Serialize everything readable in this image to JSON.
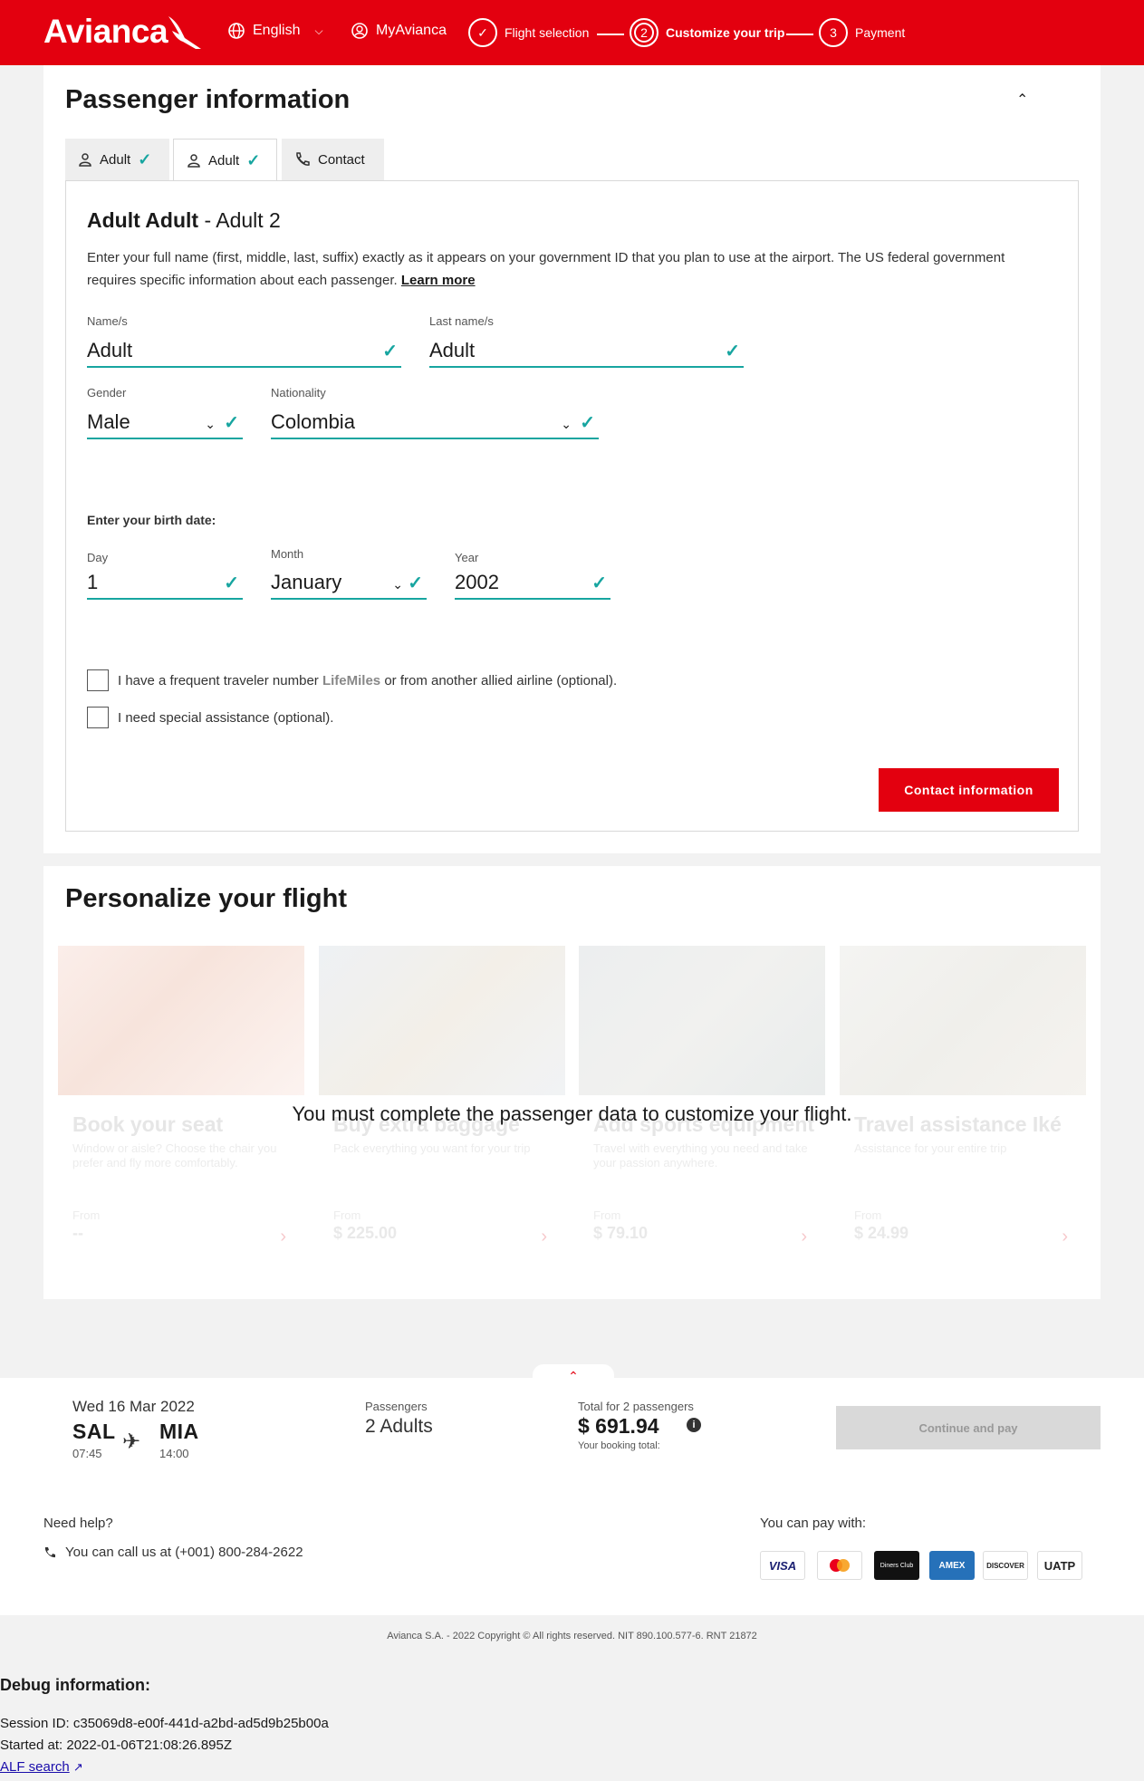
{
  "header": {
    "logo": "Avianca",
    "language": "English",
    "my_account": "MyAvianca",
    "steps": [
      {
        "number": "✓",
        "label": "Flight selection"
      },
      {
        "number": "2",
        "label": "Customize your trip"
      },
      {
        "number": "3",
        "label": "Payment"
      }
    ]
  },
  "passenger": {
    "section_title": "Passenger information",
    "tabs": [
      {
        "label": "Adult",
        "icon": "person-icon"
      },
      {
        "label": "Adult",
        "icon": "person-icon"
      },
      {
        "label": "Contact",
        "icon": "phone-icon"
      }
    ],
    "heading_bold": "Adult Adult",
    "heading_rest": " - Adult 2",
    "intro": "Enter your full name (first, middle, last, suffix) exactly as it appears on your government ID that you plan to use at the airport. The US federal government requires specific information about each passenger.",
    "learn_more": "Learn more",
    "fields": {
      "name_label": "Name/s",
      "name_value": "Adult",
      "lastname_label": "Last name/s",
      "lastname_value": "Adult",
      "gender_label": "Gender",
      "gender_value": "Male",
      "nationality_label": "Nationality",
      "nationality_value": "Colombia",
      "birth_label": "Enter your birth date:",
      "day_label": "Day",
      "day_value": "1",
      "month_label": "Month",
      "month_value": "January",
      "year_label": "Year",
      "year_value": "2002"
    },
    "checkboxes": {
      "ff_pre": "I have a frequent traveler number ",
      "ff_brand": "LifeMiles",
      "ff_post": " or from another allied airline (optional).",
      "assist": "I need special assistance (optional)."
    },
    "contact_button": "Contact information"
  },
  "personalize": {
    "section_title": "Personalize your flight",
    "overlay": "You must complete the passenger data to customize your flight.",
    "services": [
      {
        "title": "Book your seat",
        "desc": "Window or aisle? Choose the chair you prefer and fly more comfortably.",
        "from": "From",
        "price": "--"
      },
      {
        "title": "Buy extra baggage",
        "desc": "Pack everything you want for your trip",
        "from": "From",
        "price": "$ 225.00"
      },
      {
        "title": "Add sports equipment",
        "desc": "Travel with everything you need and take your passion anywhere.",
        "from": "From",
        "price": "$ 79.10"
      },
      {
        "title": "Travel assistance Iké",
        "desc": "Assistance for your entire trip",
        "from": "From",
        "price": "$ 24.99"
      }
    ]
  },
  "summary": {
    "date": "Wed 16 Mar 2022",
    "origin": "SAL",
    "origin_time": "07:45",
    "destination": "MIA",
    "destination_time": "14:00",
    "passengers_label": "Passengers",
    "passengers_value": "2 Adults",
    "total_label": "Total for 2 passengers",
    "total_value": "$ 691.94",
    "booking_label": "Your booking total:",
    "continue": "Continue and pay"
  },
  "footer": {
    "need_help": "Need help?",
    "call": "You can call us at (+001) 800-284-2622",
    "pay_with": "You can pay with:",
    "cards": [
      "VISA",
      "",
      "Diners Club",
      "AMEX",
      "DISCOVER",
      "UATP"
    ],
    "copyright": "Avianca S.A. - 2022 Copyright © All rights reserved. NIT 890.100.577-6. RNT 21872"
  },
  "debug": {
    "title": "Debug information:",
    "session": "Session ID: c35069d8-e00f-441d-a2bd-ad5d9b25b00a",
    "started": "Started at: 2022-01-06T21:08:26.895Z",
    "alf": "ALF search"
  }
}
